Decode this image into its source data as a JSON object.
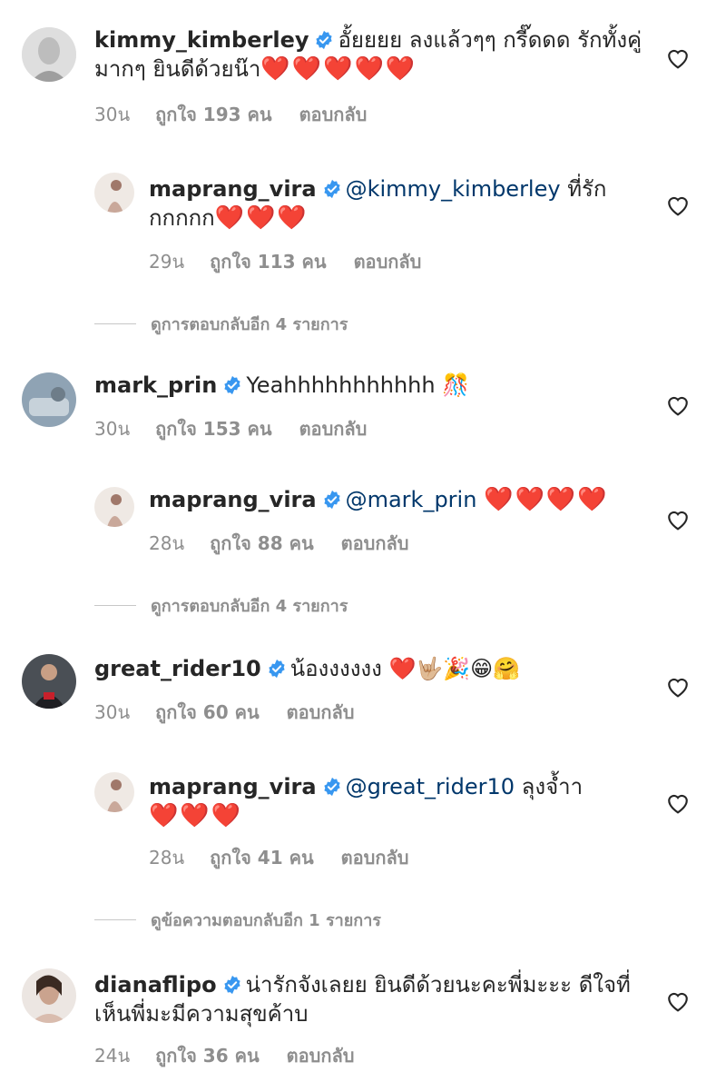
{
  "comments": [
    {
      "username": "kimmy_kimberley",
      "text": "อั้ยยยย ลงแล้วๆๆ กรี๊ดดด รักทั้งคู่มากๆ ยินดีด้วยน๊า",
      "hearts": "❤️❤️❤️❤️❤️",
      "time": "30น",
      "likes": "ถูกใจ 193 คน",
      "reply_label": "ตอบกลับ",
      "reply": {
        "username": "maprang_vira",
        "mention": "@kimmy_kimberley",
        "text": "ที่รักกกกกก",
        "hearts": "❤️❤️❤️",
        "time": "29น",
        "likes": "ถูกใจ 113 คน",
        "reply_label": "ตอบกลับ"
      },
      "view_more": "ดูการตอบกลับอีก 4 รายการ"
    },
    {
      "username": "mark_prin",
      "text": "Yeahhhhhhhhhhh",
      "emoji": "🎊",
      "time": "30น",
      "likes": "ถูกใจ 153 คน",
      "reply_label": "ตอบกลับ",
      "reply": {
        "username": "maprang_vira",
        "mention": "@mark_prin",
        "hearts": "❤️❤️❤️❤️",
        "time": "28น",
        "likes": "ถูกใจ 88 คน",
        "reply_label": "ตอบกลับ"
      },
      "view_more": "ดูการตอบกลับอีก 4 รายการ"
    },
    {
      "username": "great_rider10",
      "text": "น้องงงงงง",
      "emoji": "❤️🤟🏼🎉😁🤗",
      "time": "30น",
      "likes": "ถูกใจ 60 คน",
      "reply_label": "ตอบกลับ",
      "reply": {
        "username": "maprang_vira",
        "mention": "@great_rider10",
        "text": "ลุงจ้ำา",
        "hearts": "❤️❤️❤️",
        "time": "28น",
        "likes": "ถูกใจ 41 คน",
        "reply_label": "ตอบกลับ"
      },
      "view_more": "ดูข้อความตอบกลับอีก 1 รายการ"
    },
    {
      "username": "dianaflipo",
      "text": "น่ารักจังเลยย ยินดีด้วยนะคะพี่มะะะ ดีใจที่เห็นพี่มะมีความสุขค้าบ",
      "time": "24น",
      "likes": "ถูกใจ 36 คน",
      "reply_label": "ตอบกลับ"
    }
  ],
  "colors": {
    "verified": "#3897f0",
    "mention": "#00376b",
    "meta": "#8e8e8e",
    "heart": "#ed1c2e"
  }
}
